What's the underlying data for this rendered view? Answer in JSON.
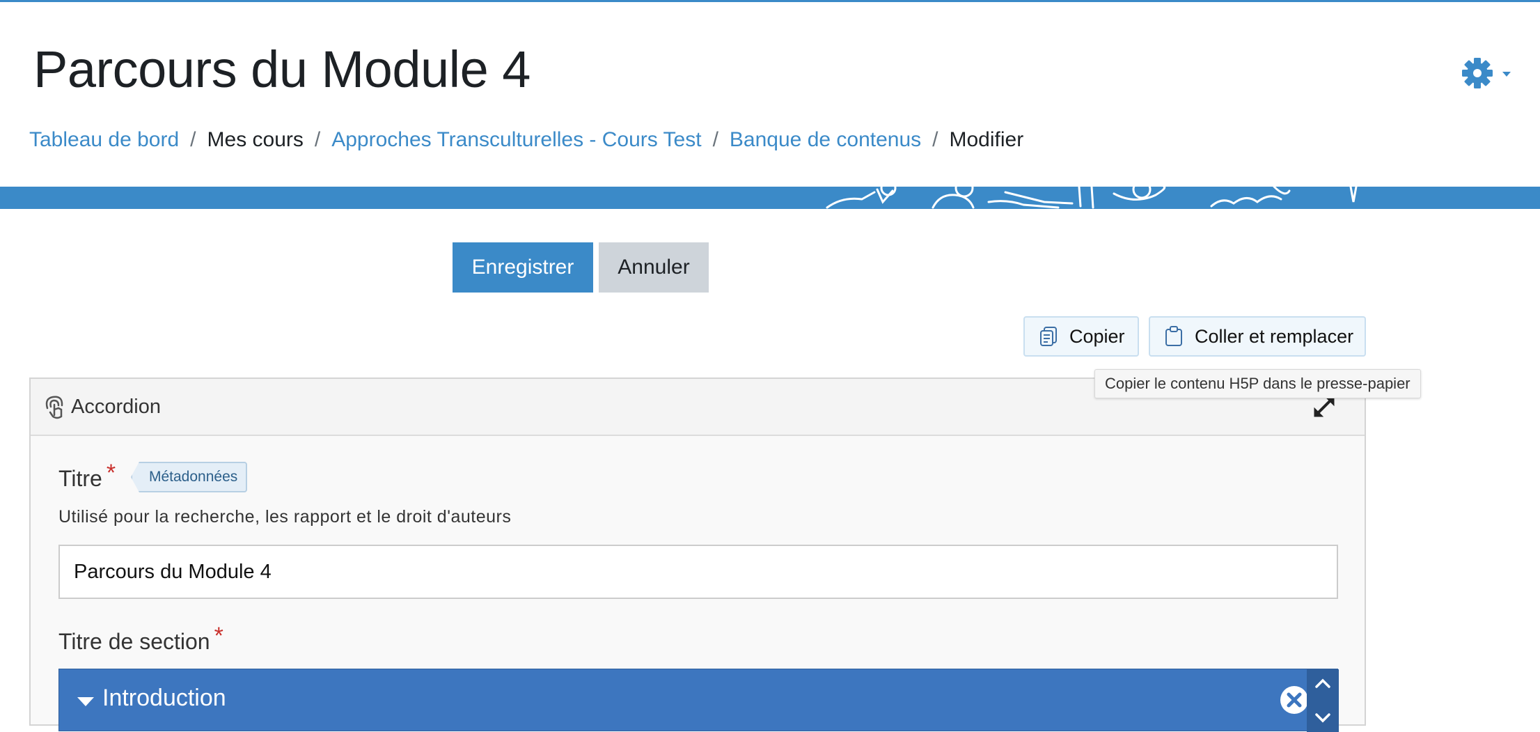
{
  "header": {
    "title": "Parcours du Module 4",
    "settings_icon": "gear-icon",
    "breadcrumb": [
      {
        "label": "Tableau de bord",
        "link": true
      },
      {
        "label": "Mes cours",
        "link": false
      },
      {
        "label": "Approches Transculturelles - Cours Test",
        "link": true
      },
      {
        "label": "Banque de contenus",
        "link": true
      },
      {
        "label": "Modifier",
        "link": false
      }
    ],
    "separator": "/"
  },
  "actions": {
    "save_label": "Enregistrer",
    "cancel_label": "Annuler"
  },
  "toolbar": {
    "copy_label": "Copier",
    "paste_label": "Coller et remplacer",
    "tooltip": "Copier le contenu H5P dans le presse-papier"
  },
  "editor": {
    "library_name": "Accordion",
    "title_field": {
      "label": "Titre",
      "required_mark": "*",
      "metadata_label": "Métadonnées",
      "description": "Utilisé pour la recherche, les rapport et le droit d'auteurs",
      "value": "Parcours du Module 4"
    },
    "section_field": {
      "label": "Titre de section",
      "required_mark": "*"
    },
    "sections": [
      {
        "label": "Introduction"
      }
    ]
  },
  "colors": {
    "brand_blue": "#3b8ac8",
    "section_blue": "#3d76bf",
    "required_red": "#c9302c"
  }
}
